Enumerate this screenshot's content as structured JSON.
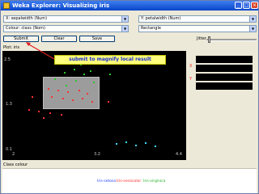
{
  "window": {
    "title": "Weka Explorer: Visualizing iris",
    "controls": {
      "minimize": "_",
      "maximize": "□",
      "close": "×"
    }
  },
  "selectors": {
    "x_axis": "X: sepalwidth (Num)",
    "y_axis": "Y: petalwidth (Num)",
    "colour": "Colour: class (Nom)",
    "shape": "Rectangle"
  },
  "buttons": {
    "submit": "Submit",
    "clear": "Clear",
    "save": "Save"
  },
  "jitter_label": "Jitter",
  "plot_label": "Plot: iris",
  "axis": {
    "y_ticks": [
      "2.5",
      "1.3",
      "0.1"
    ],
    "x_ticks": [
      "2",
      "3.2",
      "4.4"
    ]
  },
  "side_letters": [
    "X",
    "Y"
  ],
  "callout": "submit to magnify local result",
  "class_colour_label": "Class colour",
  "legend": [
    {
      "label": "Iris-setosa",
      "color": "#2040ff"
    },
    {
      "label": "Iris-versicolor",
      "color": "#ff2020"
    },
    {
      "label": "Iris-virginica",
      "color": "#20b020"
    }
  ],
  "icons": {
    "app": "weka-bird-icon",
    "combo_arrow": "chevron-down-icon"
  }
}
